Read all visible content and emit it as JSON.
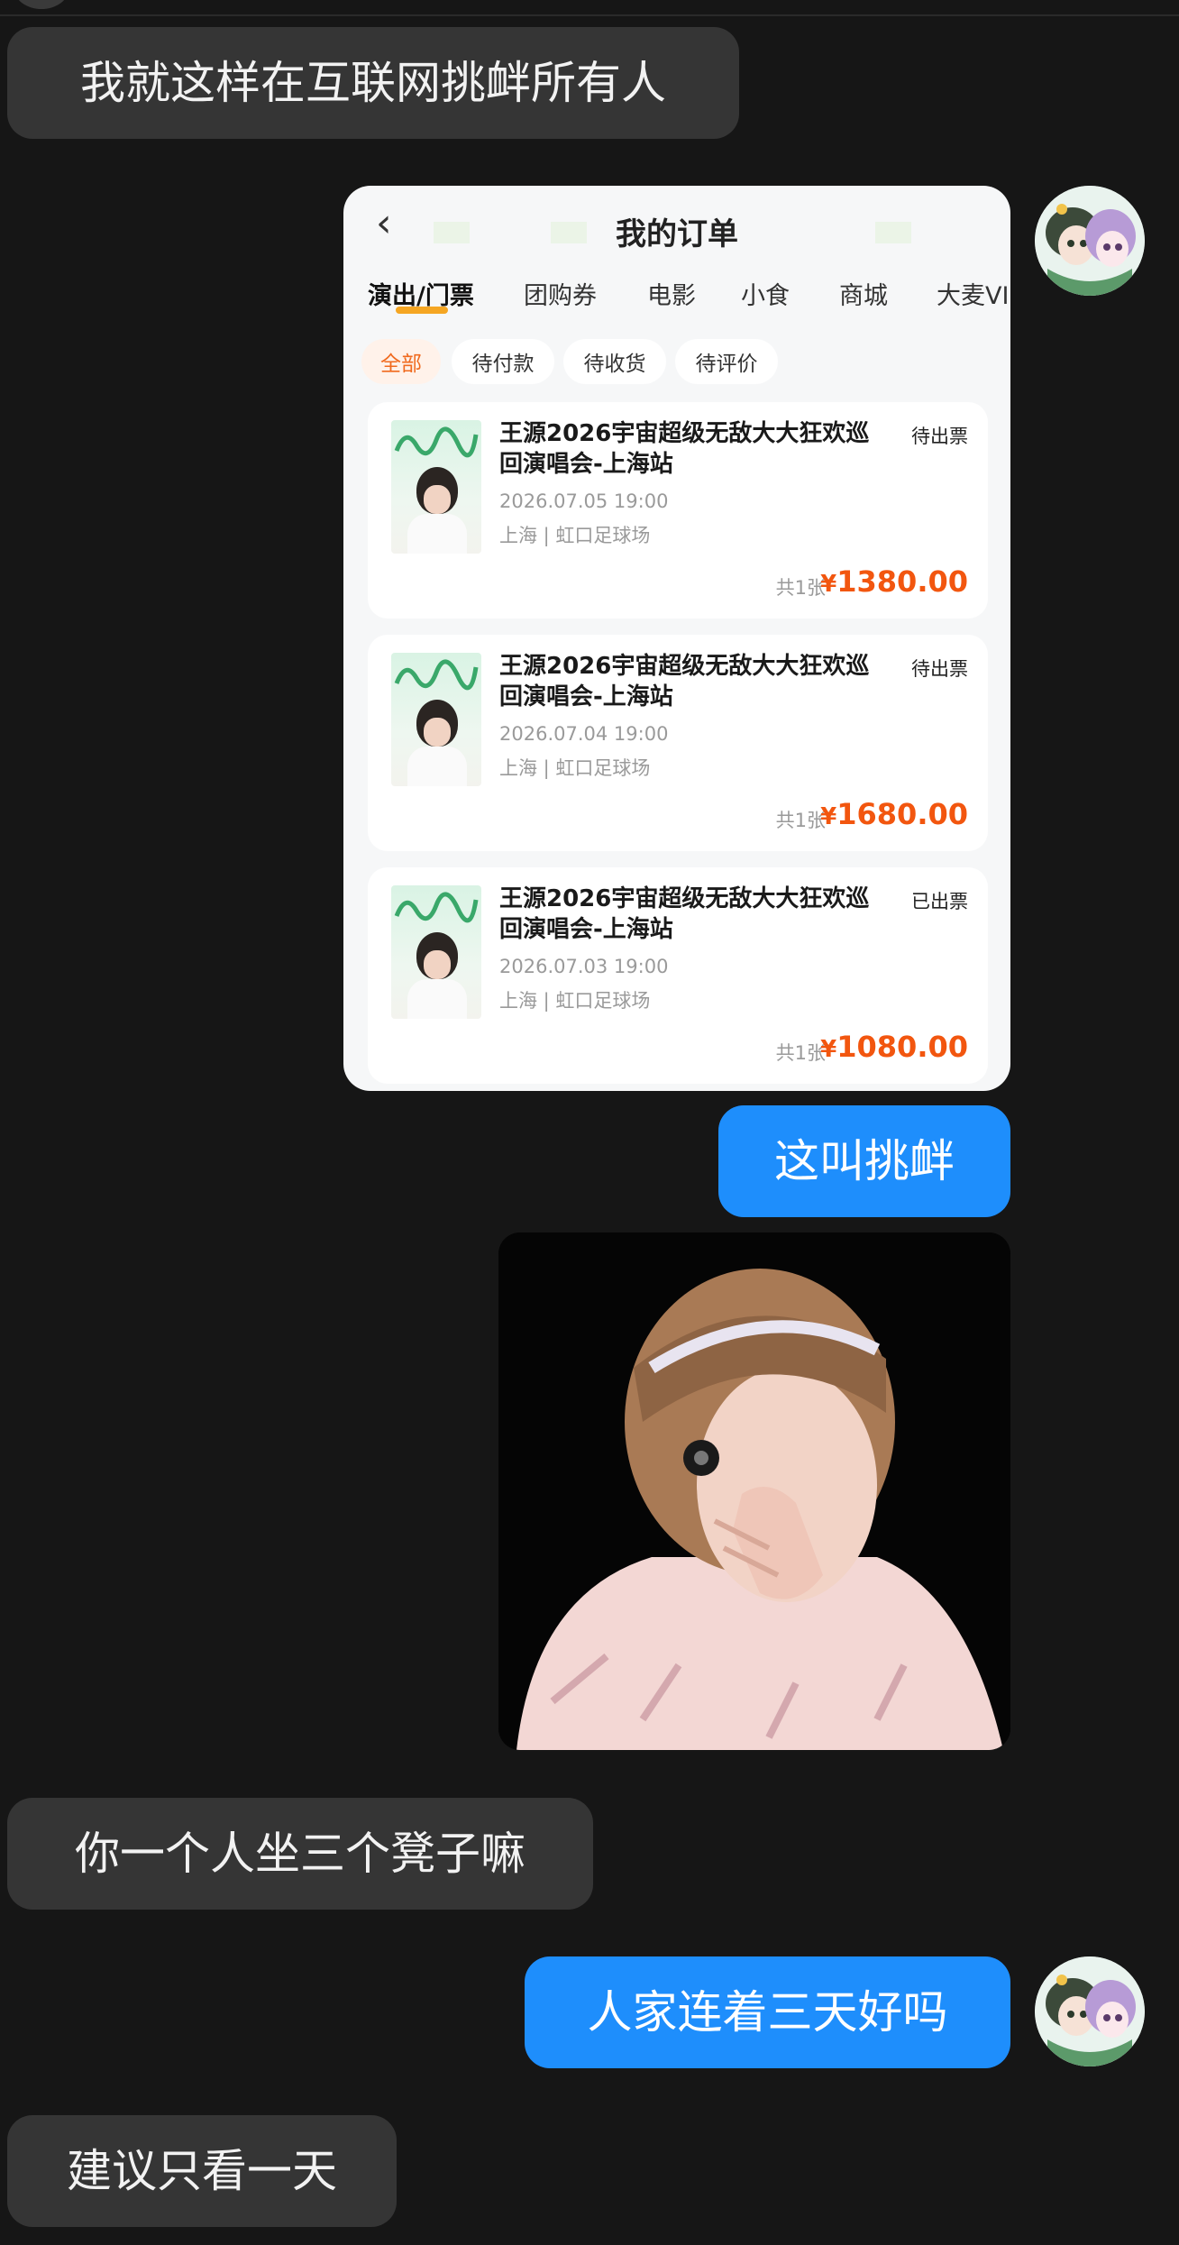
{
  "messages": {
    "m1": "我就这样在互联网挑衅所有人",
    "m2": "这叫挑衅",
    "m3": "你一个人坐三个凳子嘛",
    "m4": "人家连着三天好吗",
    "m5": "建议只看一天"
  },
  "order_screenshot": {
    "title": "我的订单",
    "back_icon": "‹",
    "tabs": [
      "演出/门票",
      "团购券",
      "电影",
      "小食",
      "商城",
      "大麦VI"
    ],
    "filters": [
      "全部",
      "待付款",
      "待收货",
      "待评价"
    ],
    "orders": [
      {
        "title": "王源2026宇宙超级无敌大大狂欢巡回演唱会-上海站",
        "status": "待出票",
        "date": "2026.07.05 19:00",
        "venue": "上海 | 虹口足球场",
        "count": "共1张",
        "currency": "¥",
        "price": "1380.00"
      },
      {
        "title": "王源2026宇宙超级无敌大大狂欢巡回演唱会-上海站",
        "status": "待出票",
        "date": "2026.07.04 19:00",
        "venue": "上海 | 虹口足球场",
        "count": "共1张",
        "currency": "¥",
        "price": "1680.00"
      },
      {
        "title": "王源2026宇宙超级无敌大大狂欢巡回演唱会-上海站",
        "status": "已出票",
        "date": "2026.07.03 19:00",
        "venue": "上海 | 虹口足球场",
        "count": "共1张",
        "currency": "¥",
        "price": "1080.00"
      }
    ]
  },
  "colors": {
    "background": "#161616",
    "incoming_bubble": "#353535",
    "outgoing_bubble": "#1e8efc",
    "price": "#f2560f",
    "tab_indicator": "#f5a623"
  },
  "icons": {
    "avatar": "anime-avatar-icon",
    "back": "back-arrow-icon"
  }
}
